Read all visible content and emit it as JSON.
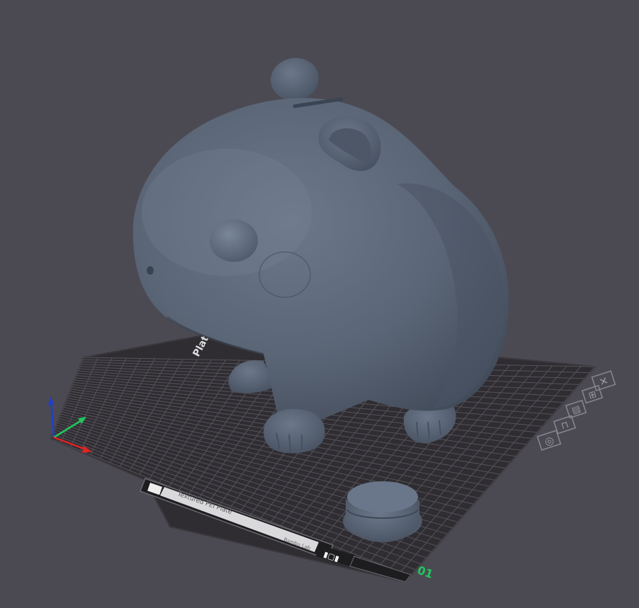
{
  "viewport": {
    "background": "#4b4a52",
    "model_color": "#5a6576",
    "plate_color": "#2f2d31",
    "grid_color": "#55535a"
  },
  "plate": {
    "label": "Plate",
    "number": "01",
    "number_color": "#22c55e",
    "bottom_text": "Textured PEI Plate",
    "bottom_subtext": "Bambu Lab",
    "icons": [
      {
        "name": "close-icon",
        "glyph": "✕"
      },
      {
        "name": "arrange-icon",
        "glyph": "⊞"
      },
      {
        "name": "orient-icon",
        "glyph": "▤"
      },
      {
        "name": "lock-icon",
        "glyph": "⊓"
      },
      {
        "name": "settings-icon",
        "glyph": "◎"
      }
    ]
  },
  "axes": {
    "x_color": "#e02424",
    "y_color": "#22c55e",
    "z_color": "#1e3fd0"
  }
}
